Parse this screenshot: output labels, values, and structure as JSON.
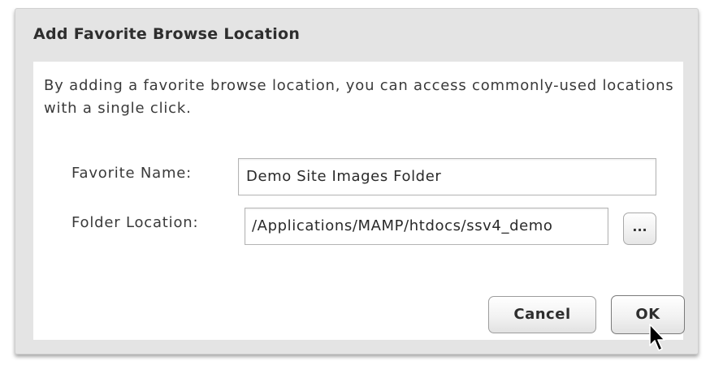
{
  "dialog": {
    "title": "Add Favorite Browse Location",
    "description": "By adding a favorite browse location, you can access commonly-used locations with a single click.",
    "favorite_name_label": "Favorite Name:",
    "favorite_name_value": "Demo Site Images Folder",
    "folder_location_label": "Folder Location:",
    "folder_location_value": "/Applications/MAMP/htdocs/ssv4_demo",
    "browse_label": "...",
    "cancel_label": "Cancel",
    "ok_label": "OK"
  },
  "icons": {
    "cursor": "arrow-cursor-icon"
  }
}
